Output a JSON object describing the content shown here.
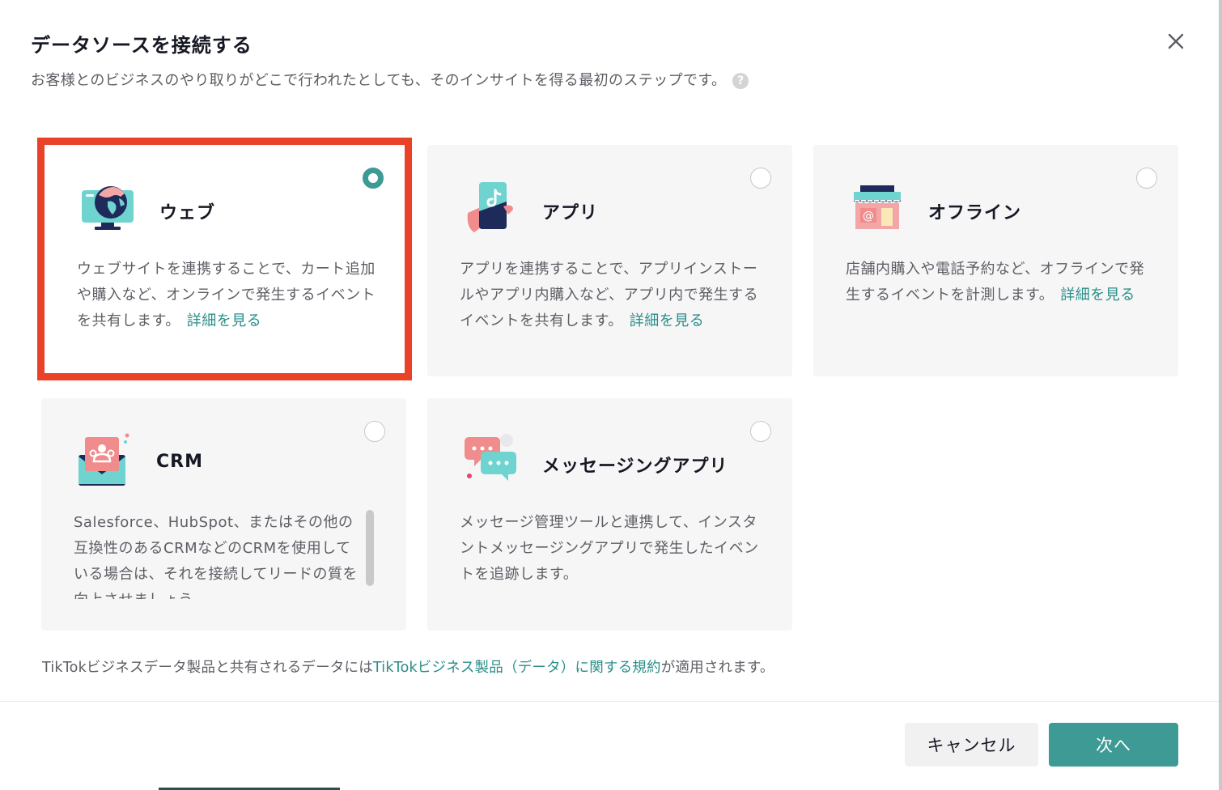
{
  "dialog": {
    "title": "データソースを接続する",
    "subtitle": "お客様とのビジネスのやり取りがどこで行われたとしても、そのインサイトを得る最初のステップです。",
    "help_glyph": "?",
    "close_glyph": "×"
  },
  "cards": [
    {
      "id": "web",
      "title": "ウェブ",
      "description": "ウェブサイトを連携することで、カート追加や購入など、オンラインで発生するイベントを共有します。",
      "link": "詳細を見る",
      "selected": true,
      "icon": "globe-monitor-icon"
    },
    {
      "id": "app",
      "title": "アプリ",
      "description": "アプリを連携することで、アプリインストールやアプリ内購入など、アプリ内で発生するイベントを共有します。",
      "link": "詳細を見る",
      "selected": false,
      "icon": "phone-in-hand-icon"
    },
    {
      "id": "offline",
      "title": "オフライン",
      "description": "店舗内購入や電話予約など、オフラインで発生するイベントを計測します。",
      "link": "詳細を見る",
      "selected": false,
      "icon": "storefront-icon"
    },
    {
      "id": "crm",
      "title": "CRM",
      "description": "Salesforce、HubSpot、またはその他の互換性のあるCRMなどのCRMを使用している場合は、それを接続してリードの質を向上させましょう",
      "selected": false,
      "icon": "contacts-envelope-icon"
    },
    {
      "id": "messaging",
      "title": "メッセージングアプリ",
      "description": "メッセージ管理ツールと連携して、インスタントメッセージングアプリで発生したイベントを追跡します。",
      "selected": false,
      "icon": "chat-bubbles-icon"
    }
  ],
  "footnote": {
    "prefix": "TikTokビジネスデータ製品と共有されるデータには",
    "link": "TikTokビジネス製品（データ）に関する規約",
    "suffix": "が適用されます。"
  },
  "buttons": {
    "cancel": "キャンセル",
    "next": "次へ"
  },
  "colors": {
    "accent": "#3d9a94",
    "link": "#2a8e88",
    "highlight_frame": "#ea4129"
  }
}
